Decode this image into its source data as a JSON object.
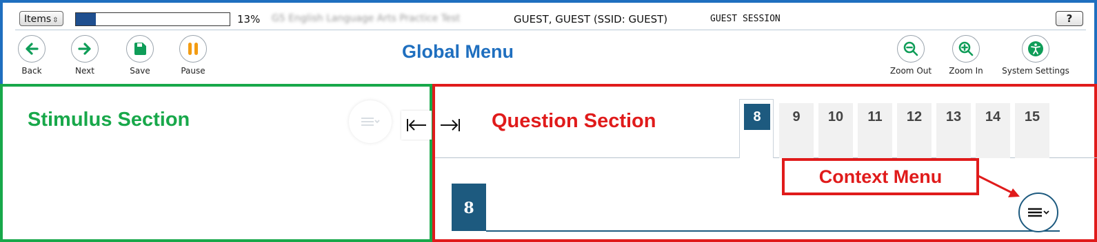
{
  "topbar": {
    "items_label": "Items",
    "progress_percent": 13,
    "progress_text": "13%",
    "test_name": "G5 English Language Arts Practice Test",
    "user": "GUEST, GUEST (SSID: GUEST)",
    "session": "GUEST SESSION",
    "help_label": "?"
  },
  "nav": {
    "back": "Back",
    "next": "Next",
    "save": "Save",
    "pause": "Pause",
    "zoom_out": "Zoom Out",
    "zoom_in": "Zoom In",
    "system_settings": "System Settings"
  },
  "annotations": {
    "global_menu": "Global Menu",
    "stimulus_section": "Stimulus Section",
    "question_section": "Question Section",
    "context_menu": "Context Menu"
  },
  "question": {
    "tabs": [
      "8",
      "9",
      "10",
      "11",
      "12",
      "13",
      "14",
      "15"
    ],
    "active_tab": "8",
    "current_number": "8"
  },
  "colors": {
    "global_border": "#1f6fbf",
    "stimulus_border": "#18a84a",
    "question_border": "#e01b1b",
    "nav_green": "#0f9d58",
    "pause_orange": "#f39c12",
    "item_blue": "#1d5a7f"
  }
}
